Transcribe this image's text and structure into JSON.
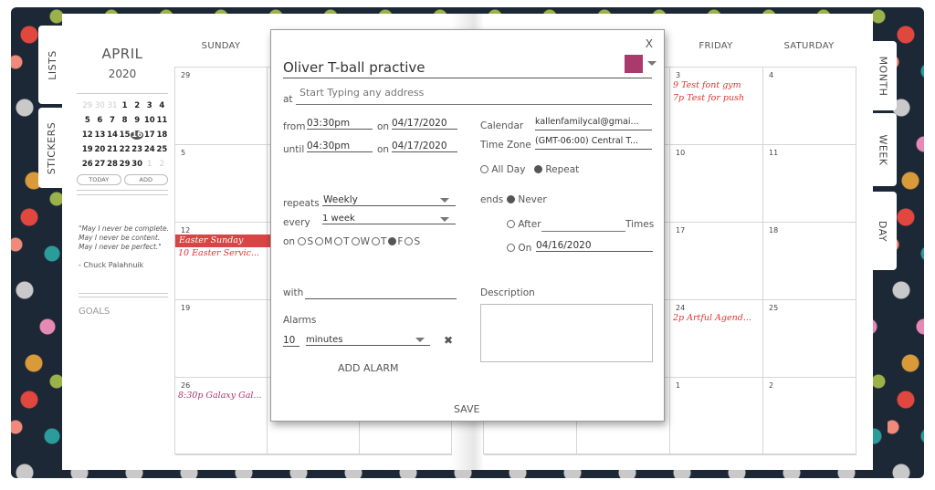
{
  "left_tabs": [
    "LISTS",
    "STICKERS"
  ],
  "right_tabs": [
    "MONTH",
    "WEEK",
    "DAY"
  ],
  "sidebar": {
    "month": "APRIL",
    "year": "2020",
    "mini_calendar": [
      [
        "29",
        "30",
        "31",
        "1",
        "2",
        "3",
        "4"
      ],
      [
        "5",
        "6",
        "7",
        "8",
        "9",
        "10",
        "11"
      ],
      [
        "12",
        "13",
        "14",
        "15",
        "16",
        "17",
        "18"
      ],
      [
        "19",
        "20",
        "21",
        "22",
        "23",
        "24",
        "25"
      ],
      [
        "26",
        "27",
        "28",
        "29",
        "30",
        "1",
        "2"
      ]
    ],
    "selected_day": "16",
    "today_label": "TODAY",
    "add_label": "ADD",
    "quote": "\"May I never be complete. May I never be content. May I never be perfect.\"",
    "author": "- Chuck Palahnuik",
    "goals": "GOALS"
  },
  "left_days": [
    "SUNDAY",
    "",
    ""
  ],
  "right_days": [
    "",
    "",
    "FRIDAY",
    "SATURDAY"
  ],
  "sunday_cells": [
    {
      "date": "29",
      "events": []
    },
    {
      "date": "5",
      "events": []
    },
    {
      "date": "12",
      "events": [
        {
          "text": "Easter Sunday",
          "allday": true
        },
        {
          "text": "10 Easter Servic..."
        }
      ]
    },
    {
      "date": "19",
      "events": []
    },
    {
      "date": "26",
      "events": [
        {
          "text": "8:30p Galaxy Gal...",
          "color": "#a8336a"
        }
      ]
    }
  ],
  "friday_cells": [
    {
      "date": "3",
      "events": [
        {
          "text": "9 Test font gym"
        },
        {
          "text": "7p Test for push"
        }
      ]
    },
    {
      "date": "10",
      "events": []
    },
    {
      "date": "17",
      "events": []
    },
    {
      "date": "24",
      "events": [
        {
          "text": "2p Artful Agend..."
        }
      ]
    },
    {
      "date": "1",
      "events": []
    }
  ],
  "saturday_cells": [
    {
      "date": "4"
    },
    {
      "date": "11"
    },
    {
      "date": "18"
    },
    {
      "date": "25"
    },
    {
      "date": "2"
    }
  ],
  "modal": {
    "close": "X",
    "title": "Oliver T-ball practive",
    "color": "#a83a6e",
    "at_label": "at",
    "address_placeholder": "Start Typing any address",
    "from_label": "from",
    "from_time": "03:30pm",
    "on_label": "on",
    "from_date": "04/17/2020",
    "until_label": "until",
    "until_time": "04:30pm",
    "until_date": "04/17/2020",
    "calendar_label": "Calendar",
    "calendar": "kallenfamilycal@gmai...",
    "timezone_label": "Time Zone",
    "timezone": "(GMT-06:00) Central T...",
    "allday_label": "All Day",
    "repeat_label": "Repeat",
    "repeat_checked": true,
    "repeats_label": "repeats",
    "repeats": "Weekly",
    "every_label": "every",
    "every": "1 week",
    "weekdays": [
      "S",
      "M",
      "T",
      "W",
      "T",
      "F",
      "S"
    ],
    "weekday_selected": 5,
    "ends_label": "ends",
    "never_label": "Never",
    "after_label": "After",
    "times_label": "Times",
    "on_end_label": "On",
    "end_date": "04/16/2020",
    "with_label": "with",
    "description_label": "Description",
    "alarms_label": "Alarms",
    "alarm_value": "10",
    "alarm_unit": "minutes",
    "add_alarm": "ADD ALARM",
    "save": "SAVE"
  }
}
